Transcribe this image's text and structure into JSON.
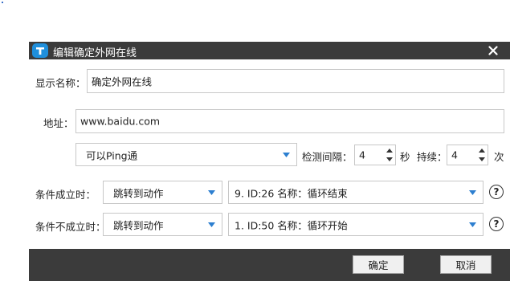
{
  "dialog": {
    "title": "编辑确定外网在线",
    "display_name": {
      "label": "显示名称：",
      "value": "确定外网在线"
    },
    "address": {
      "label": "地址：",
      "value": "www.baidu.com"
    },
    "check": {
      "mode_value": "可以Ping通",
      "interval_label": "检测间隔：",
      "interval_value": "4",
      "interval_unit": "秒",
      "duration_label": "持续：",
      "duration_value": "4",
      "duration_unit": "次"
    },
    "condition_true": {
      "label": "条件成立时：",
      "action_value": "跳转到动作",
      "target_value": "9. ID:26 名称：循环结束",
      "help": "?"
    },
    "condition_false": {
      "label": "条件不成立时：",
      "action_value": "跳转到动作",
      "target_value": "1. ID:50 名称：循环开始",
      "help": "?"
    },
    "buttons": {
      "ok": "确定",
      "cancel": "取消"
    }
  },
  "colors": {
    "titlebar": "#3b3b3b",
    "logo": "#1f8fdb",
    "dropdown_caret": "#2d7fd0"
  },
  "icons": {
    "logo": "app-logo-icon",
    "close": "close-icon",
    "caret": "chevron-down-icon",
    "help": "help-icon"
  }
}
